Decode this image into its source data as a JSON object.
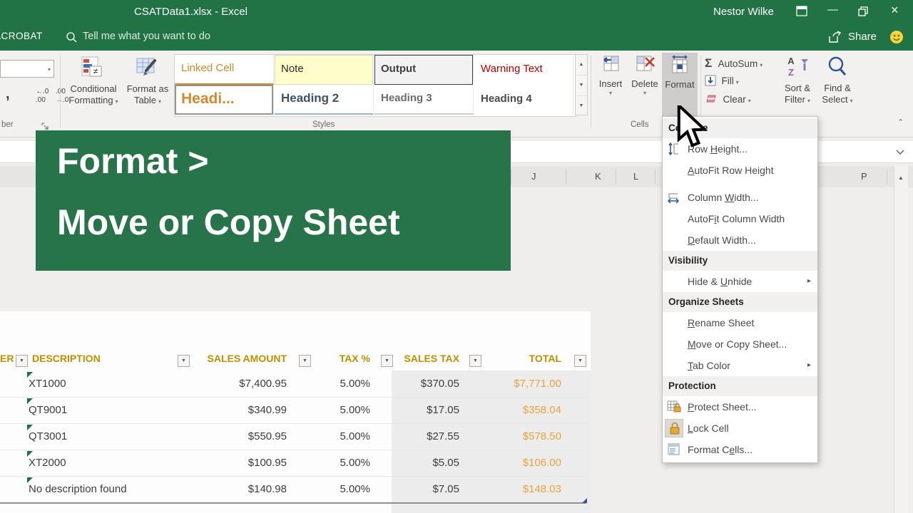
{
  "titlebar": {
    "title": "CSATData1.xlsx  -  Excel",
    "user": "Nestor Wilke"
  },
  "tab_row": {
    "acrobat": "ACROBAT",
    "tell_me": "Tell me what you want to do",
    "share": "Share"
  },
  "ribbon": {
    "number_group": {
      "group_label": "ber",
      "comma": ",",
      "increase_decimal": "←.0\n.00",
      "decrease_decimal": ".00\n→.0"
    },
    "conditional_formatting": "Conditional Formatting",
    "format_as_table": "Format as Table",
    "styles": {
      "group_label": "Styles",
      "linked_cell": "Linked Cell",
      "note": "Note",
      "output": "Output",
      "warning_text": "Warning Text",
      "heading1": "Headi...",
      "heading2": "Heading 2",
      "heading3": "Heading 3",
      "heading4": "Heading 4"
    },
    "cells_group": {
      "group_label": "Cells",
      "insert": "Insert",
      "delete": "Delete",
      "format": "Format"
    },
    "editing_group": {
      "autosum": "AutoSum",
      "fill": "Fill",
      "clear": "Clear",
      "sort_filter": "Sort & Filter",
      "find_select": "Find & Select"
    }
  },
  "banner": {
    "line1": "Format >",
    "line2": "Move or Copy Sheet"
  },
  "sheet": {
    "columns": [
      "J",
      "K",
      "L",
      "P"
    ]
  },
  "format_menu": {
    "sections": [
      {
        "header": "Cell Size",
        "items": [
          {
            "html": "Row <u>H</u>eight..."
          },
          {
            "html": "<u>A</u>utoFit Row Height"
          },
          {
            "html": "Column <u>W</u>idth..."
          },
          {
            "html": "AutoF<u>i</u>t Column Width"
          },
          {
            "html": "<u>D</u>efault Width..."
          }
        ]
      },
      {
        "header": "Visibility",
        "items": [
          {
            "html": "Hide &amp; <u>U</u>nhide"
          }
        ]
      },
      {
        "header": "Organize Sheets",
        "items": [
          {
            "html": "<u>R</u>ename Sheet"
          },
          {
            "html": "<u>M</u>ove or Copy Sheet..."
          },
          {
            "html": "<u>T</u>ab Color"
          }
        ]
      },
      {
        "header": "Protection",
        "items": [
          {
            "html": "<u>P</u>rotect Sheet..."
          },
          {
            "html": "<u>L</u>ock Cell"
          },
          {
            "html": "Format C<u>e</u>lls..."
          }
        ]
      }
    ]
  },
  "table": {
    "headers": [
      "ER",
      "DESCRIPTION",
      "SALES AMOUNT",
      "TAX %",
      "SALES TAX",
      "TOTAL"
    ],
    "rows": [
      [
        "XT1000",
        "$7,400.95",
        "5.00%",
        "$370.05",
        "$7,771.00"
      ],
      [
        "QT9001",
        "$340.99",
        "5.00%",
        "$17.05",
        "$358.04"
      ],
      [
        "QT3001",
        "$550.95",
        "5.00%",
        "$27.55",
        "$578.50"
      ],
      [
        "XT2000",
        "$100.95",
        "5.00%",
        "$5.05",
        "$106.00"
      ],
      [
        "No description found",
        "$140.98",
        "5.00%",
        "$7.05",
        "$148.03"
      ]
    ]
  },
  "colors": {
    "excel_green": "#217346",
    "banner_green": "#27744a",
    "gold_header": "#bf8f00",
    "total_orange": "#e8a33d"
  }
}
